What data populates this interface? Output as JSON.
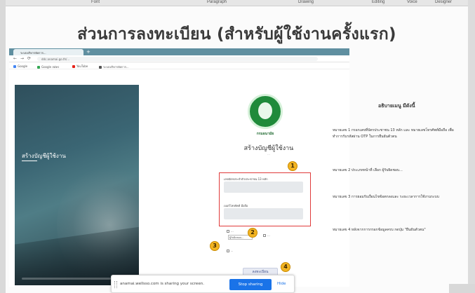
{
  "ribbon": {
    "items": [
      "Font",
      "Paragraph",
      "Drawing",
      "Editing",
      "Voice",
      "Designer"
    ]
  },
  "slide": {
    "title": "ส่วนการลงทะเบียน (สำหรับผู้ใช้งานครั้งแรก)"
  },
  "browser": {
    "tab_title": "ระบบบริหารจัดการ...",
    "tab_plus": "+",
    "nav_back": "←",
    "nav_forward": "→",
    "nav_reload": "⟳",
    "url": "ddc.anamai.go.th/...",
    "bookmarks": [
      "Google",
      "Google สมัคร",
      "YouTube",
      "ระบบบริหารจัดการ..."
    ]
  },
  "hero": {
    "title": "สร้างบัญชีผู้ใช้งาน"
  },
  "form": {
    "logo_text": "กรมอนามัย",
    "title": "สร้างบัญชีผู้ใช้งาน",
    "subtitle": "...",
    "field1_label": "เลขบัตรประจำตัวประชาชน 13 หลัก",
    "field2_label": "เบอร์โทรศัพท์ มือถือ",
    "option1_label": "...",
    "option2_label": "...",
    "select_value": "ผู้รับผิดชอบ...",
    "consent_text": "...",
    "submit_label": "ลงทะเบียน",
    "badges": [
      "1",
      "2",
      "3",
      "4"
    ]
  },
  "notes": {
    "title": "อธิบายเมนู มีดังนี้",
    "items": [
      "หมายเลข 1 กรอกเลขที่บัตรประชาชน 13 หลัก และ หมายเลขโทรศัพท์มือถือ เพื่อทำการรับรหัสผ่าน OTP ในการยืนยันตัวตน",
      "หมายเลข 2 ประเภทหน้าที่ เลือก ผู้รับผิดชอบ...",
      "หมายเลข 3 การยอมรับเงื่อนไขข้อตกลงและ ระยะเวลาการใช้งานระบบ",
      "หมายเลข 4 หลังจากการกรอกข้อมูลครบ กดปุ่ม \"ยืนยันตัวตน\""
    ]
  },
  "sharebar": {
    "text": "anamai.wellsso.com is sharing your screen.",
    "stop_label": "Stop sharing",
    "hide_label": "Hide"
  }
}
